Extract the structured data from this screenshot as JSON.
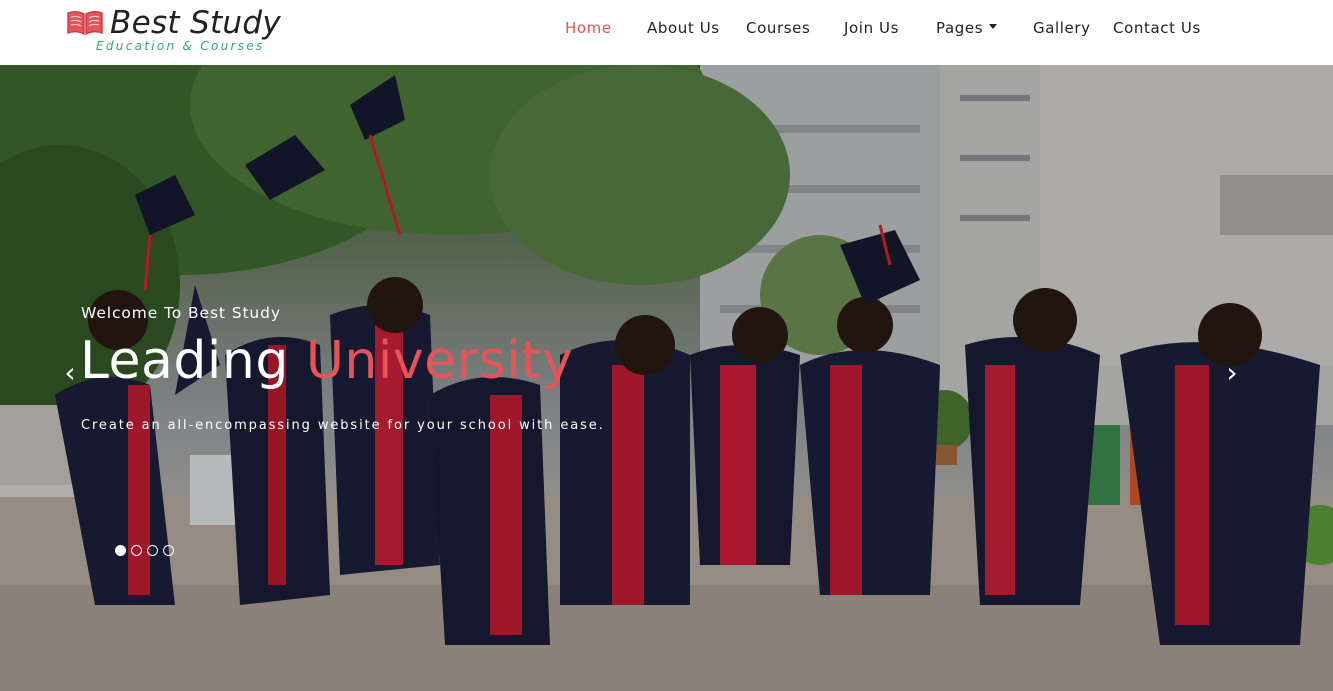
{
  "brand": {
    "title": "Best Study",
    "tagline": "Education & Courses",
    "accent_color": "#e8535a",
    "tagline_color": "#3aa56b",
    "icon": "open-book-icon"
  },
  "nav": {
    "items": [
      {
        "label": "Home",
        "active": true
      },
      {
        "label": "About Us",
        "active": false
      },
      {
        "label": "Courses",
        "active": false
      },
      {
        "label": "Join Us",
        "active": false
      },
      {
        "label": "Pages",
        "active": false,
        "dropdown": true
      },
      {
        "label": "Gallery",
        "active": false
      },
      {
        "label": "Contact Us",
        "active": false
      }
    ]
  },
  "hero": {
    "welcome": "Welcome To Best Study",
    "headline_part1": "Leading",
    "headline_part2": "University",
    "subtitle": "Create an all-encompassing website for your school with ease.",
    "prev_icon": "chevron-left-icon",
    "next_icon": "chevron-right-icon",
    "prev_glyph": "‹",
    "next_glyph": "›",
    "slides_total": 4,
    "active_slide": 1,
    "image": "graduates-jumping-photo"
  }
}
